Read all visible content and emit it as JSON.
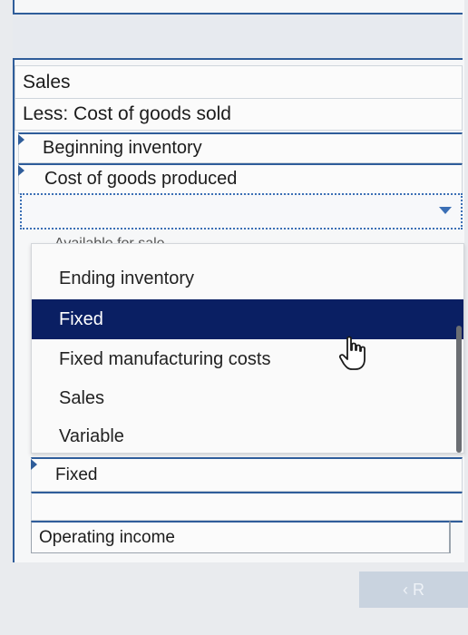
{
  "rows": {
    "sales": "Sales",
    "less_cogs": "Less: Cost of goods sold",
    "beginning_inventory": "Beginning inventory",
    "cost_goods_produced": "Cost of goods produced",
    "partial_hidden_label": "Available for sale",
    "selected_below": "Fixed",
    "operating_income": "Operating income"
  },
  "dropdown": {
    "options": [
      {
        "label": "Ending inventory",
        "selected": false
      },
      {
        "label": "Fixed",
        "selected": true
      },
      {
        "label": "Fixed manufacturing costs",
        "selected": false
      },
      {
        "label": "Sales",
        "selected": false
      },
      {
        "label": "Variable",
        "selected": false
      }
    ]
  },
  "navigation": {
    "next_label": "‹ R"
  },
  "colors": {
    "accent_blue": "#2f5d9a",
    "selected_bg": "#0a1f63",
    "select_border": "#3b6fb5"
  }
}
